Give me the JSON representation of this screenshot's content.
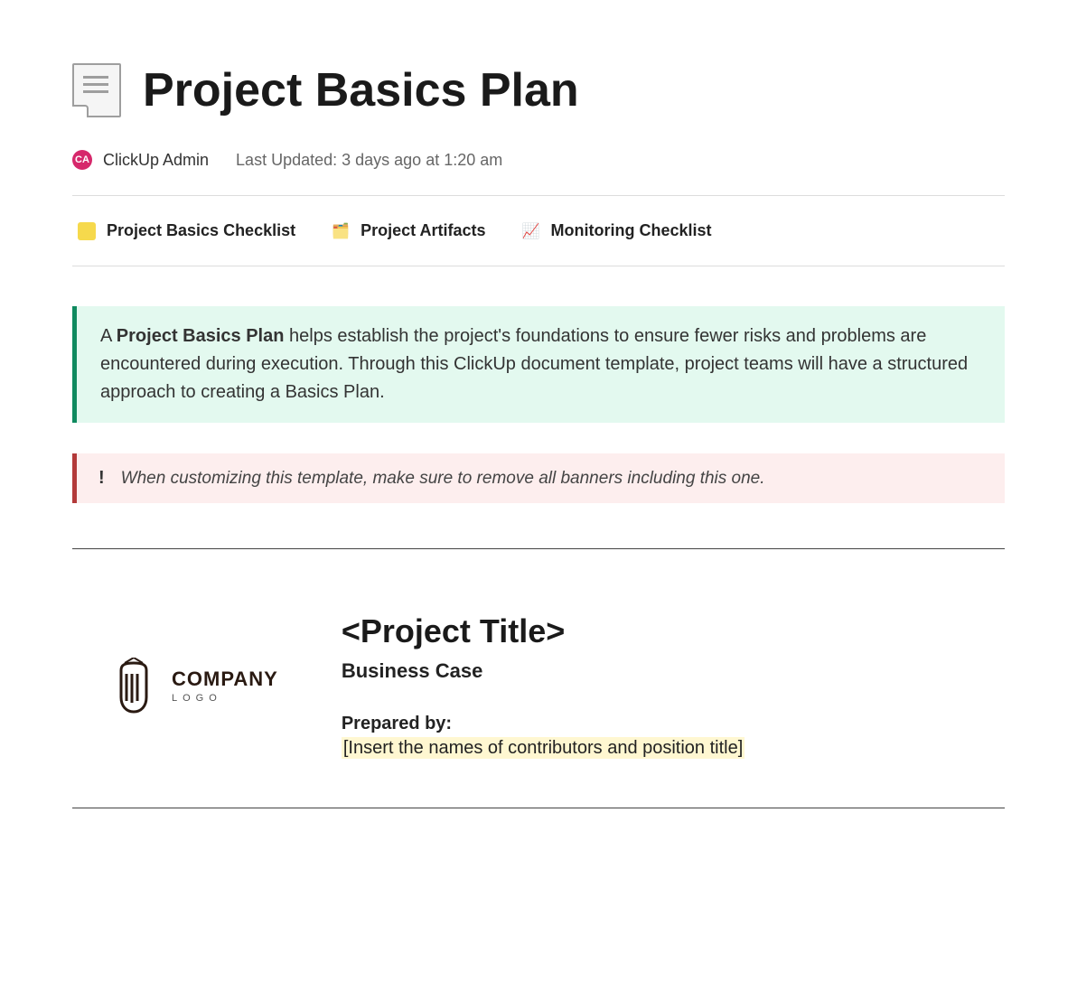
{
  "header": {
    "title": "Project Basics Plan",
    "avatar_initials": "CA",
    "author": "ClickUp Admin",
    "last_updated": "Last Updated: 3 days ago at 1:20 am"
  },
  "subpages": [
    {
      "label": "Project Basics Checklist"
    },
    {
      "label": "Project Artifacts"
    },
    {
      "label": "Monitoring Checklist"
    }
  ],
  "callout_green": {
    "bold": "Project Basics Plan",
    "prefix": "A ",
    "rest": " helps establish the project's foundations to ensure fewer risks and problems are encountered during execution. Through this ClickUp document template, project teams will have a structured approach to creating a Basics Plan."
  },
  "callout_red": {
    "bang": "!",
    "text": "When customizing this template, make sure to remove all banners including this one."
  },
  "logo": {
    "company": "COMPANY",
    "sub": "LOGO"
  },
  "title_block": {
    "project_title": "<Project Title>",
    "subtitle": "Business Case",
    "prepared_label": "Prepared by:",
    "prepared_value": "[Insert the names of contributors and position title]"
  }
}
